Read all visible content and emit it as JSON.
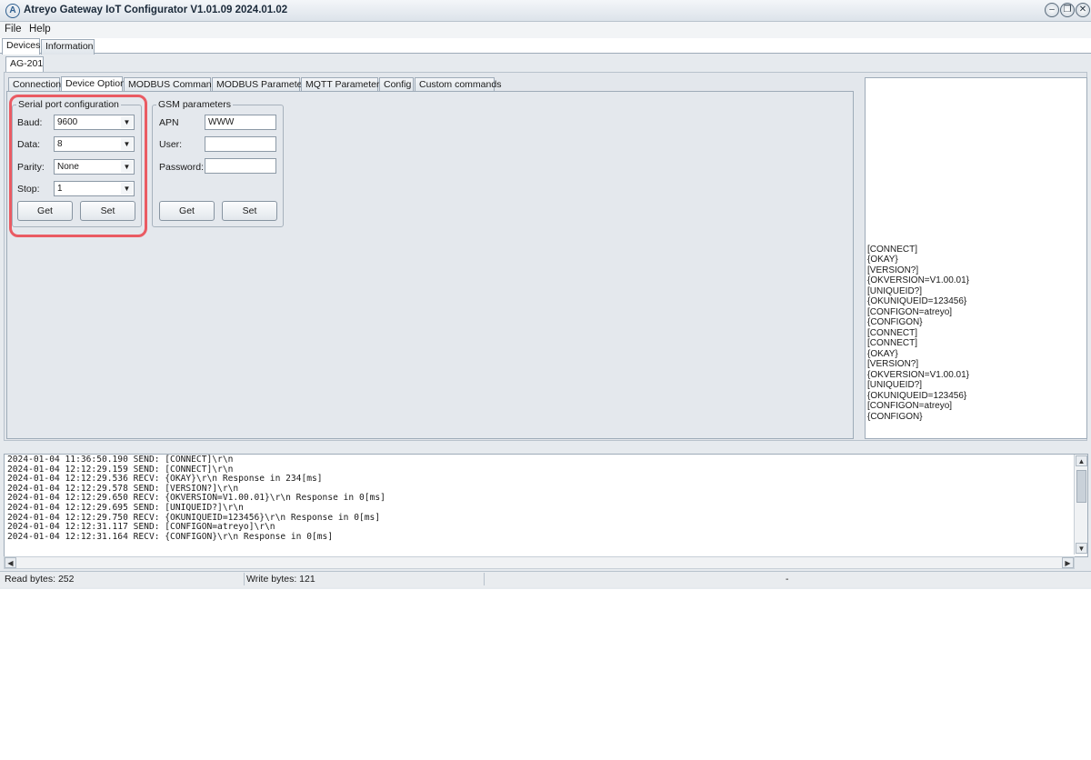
{
  "window": {
    "title": "Atreyo Gateway  IoT Configurator V1.01.09 2024.01.02",
    "app_icon_glyph": "A",
    "controls": {
      "minimize": "–",
      "restore": "❐",
      "close": "✕"
    }
  },
  "menu": {
    "file": "File",
    "help": "Help"
  },
  "top_tabs": {
    "devices": "Devices",
    "information": "Information"
  },
  "device_tab": "AG-201",
  "option_tabs": [
    "Connection",
    "Device Option",
    "MODBUS Commands",
    "MODBUS Parameters",
    "MQTT Parameters",
    "Config",
    "Custom commands"
  ],
  "serial": {
    "legend": "Serial port configuration",
    "baud_label": "Baud:",
    "baud_value": "9600",
    "data_label": "Data:",
    "data_value": "8",
    "parity_label": "Parity:",
    "parity_value": "None",
    "stop_label": "Stop:",
    "stop_value": "1",
    "get_label": "Get",
    "set_label": "Set"
  },
  "gsm": {
    "legend": "GSM parameters",
    "apn_label": "APN",
    "apn_value": "WWW",
    "user_label": "User:",
    "user_value": "",
    "password_label": "Password:",
    "password_value": "",
    "get_label": "Get",
    "set_label": "Set"
  },
  "right_log": [
    "[CONNECT]",
    "{OKAY}",
    "[VERSION?]",
    "{OKVERSION=V1.00.01}",
    "[UNIQUEID?]",
    "{OKUNIQUEID=123456}",
    "[CONFIGON=atreyo]",
    "{CONFIGON}",
    "[CONNECT]",
    "[CONNECT]",
    "{OKAY}",
    "[VERSION?]",
    "{OKVERSION=V1.00.01}",
    "[UNIQUEID?]",
    "{OKUNIQUEID=123456}",
    "[CONFIGON=atreyo]",
    "{CONFIGON}"
  ],
  "bottom_log": [
    "2024-01-04 11:36:50.190 SEND: [CONNECT]\\r\\n",
    "2024-01-04 12:12:29.159 SEND: [CONNECT]\\r\\n",
    "2024-01-04 12:12:29.536 RECV: {OKAY}\\r\\n Response in 234[ms]",
    "2024-01-04 12:12:29.578 SEND: [VERSION?]\\r\\n",
    "2024-01-04 12:12:29.650 RECV: {OKVERSION=V1.00.01}\\r\\n Response in 0[ms]",
    "2024-01-04 12:12:29.695 SEND: [UNIQUEID?]\\r\\n",
    "2024-01-04 12:12:29.750 RECV: {OKUNIQUEID=123456}\\r\\n Response in 0[ms]",
    "2024-01-04 12:12:31.117 SEND: [CONFIGON=atreyo]\\r\\n",
    "2024-01-04 12:12:31.164 RECV: {CONFIGON}\\r\\n Response in 0[ms]"
  ],
  "scroll_arrows": {
    "up": "▲",
    "down": "▼",
    "left": "◀",
    "right": "▶"
  },
  "combo_arrow": "▼",
  "status": {
    "read_bytes": "Read bytes: 252",
    "write_bytes": "Write bytes: 121",
    "extra": "-"
  },
  "colors": {
    "highlight": "#ea5b63"
  }
}
